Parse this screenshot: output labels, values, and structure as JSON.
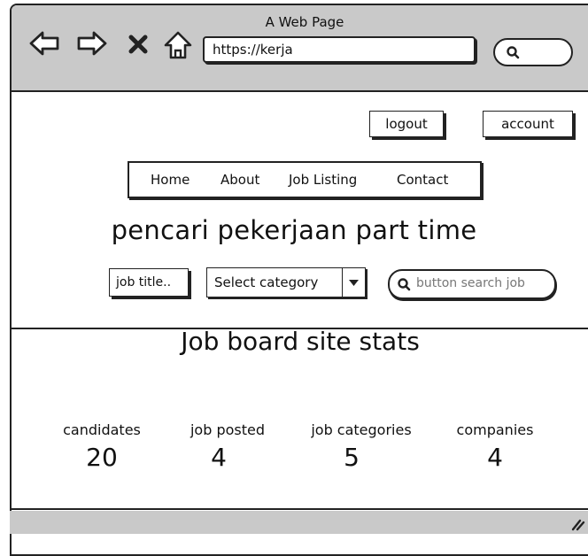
{
  "window": {
    "title": "A Web Page"
  },
  "browser": {
    "url": "https://kerja",
    "icons": [
      "back-arrow-icon",
      "forward-arrow-icon",
      "close-x-icon",
      "home-icon",
      "search-icon"
    ]
  },
  "header": {
    "logout_label": "logout",
    "account_label": "account"
  },
  "nav": {
    "items": [
      "Home",
      "About",
      "Job Listing",
      "Contact"
    ]
  },
  "hero": {
    "headline": "pencari pekerjaan part time"
  },
  "search": {
    "job_title_input": "job title..",
    "category_select": "Select category",
    "search_button": "button search job"
  },
  "stats": {
    "title": "Job board site stats",
    "items": [
      {
        "label": "candidates",
        "value": "20"
      },
      {
        "label": "job posted",
        "value": "4"
      },
      {
        "label": "job categories",
        "value": "5"
      },
      {
        "label": "companies",
        "value": "4"
      }
    ]
  },
  "colors": {
    "chrome": "#c9c9c9",
    "outline": "#222222",
    "placeholder": "#777777"
  }
}
